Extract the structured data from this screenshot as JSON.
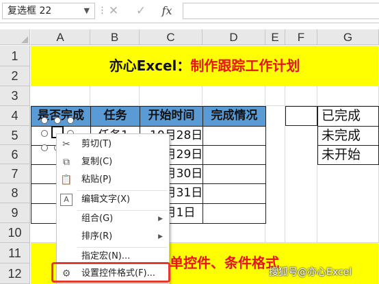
{
  "formula_bar": {
    "name_box": "复选框 22",
    "name_box_dropdown": "▼",
    "dots": "⋮",
    "cancel_icon": "✕",
    "enter_icon": "✓",
    "fx_label": "fx",
    "formula": ""
  },
  "columns": [
    "A",
    "B",
    "C",
    "D",
    "E",
    "F",
    "G"
  ],
  "rows": [
    "1",
    "2",
    "3",
    "4",
    "5",
    "6",
    "7",
    "8",
    "9",
    "10",
    "11",
    "12"
  ],
  "title": {
    "prefix": "亦心Excel：",
    "text": "制作跟踪工作计划"
  },
  "table": {
    "headers": [
      "是否完成",
      "任务",
      "开始时间",
      "完成情况"
    ],
    "rows": [
      {
        "task": "任务1",
        "date": "10月28日"
      },
      {
        "task": "",
        "date": "10月29日"
      },
      {
        "task": "",
        "date": "10月30日"
      },
      {
        "task": "",
        "date": "10月31日"
      },
      {
        "task": "",
        "date": "11月1日"
      }
    ]
  },
  "status_list": [
    "已完成",
    "未完成",
    "未开始"
  ],
  "bottom_banner": "单控件、条件格式",
  "context_menu": {
    "items": [
      {
        "label": "剪切(T)",
        "icon": "scissors-icon",
        "glyph": "✂",
        "disabled": false
      },
      {
        "label": "复制(C)",
        "icon": "copy-icon",
        "glyph": "⧉",
        "disabled": false
      },
      {
        "label": "粘贴(P)",
        "icon": "paste-icon",
        "glyph": "📋",
        "disabled": false
      },
      {
        "label": "编辑文字(X)",
        "icon": "edit-text-icon",
        "glyph": "A",
        "disabled": false
      },
      {
        "label": "组合(G)",
        "icon": "",
        "glyph": "",
        "disabled": false,
        "submenu": true
      },
      {
        "label": "排序(R)",
        "icon": "",
        "glyph": "",
        "disabled": false,
        "submenu": true
      },
      {
        "label": "指定宏(N)...",
        "icon": "",
        "glyph": "",
        "disabled": false
      },
      {
        "label": "设置控件格式(F)...",
        "icon": "format-control-icon",
        "glyph": "⚙",
        "disabled": false,
        "highlighted": true
      }
    ],
    "submenu_arrow": "▶"
  },
  "watermark": "搜狐号@亦心Excel",
  "colors": {
    "banner": "#ffff00",
    "title_red": "#e8141b",
    "header_blue": "#5b9bd5",
    "highlight_box": "#e53a2b"
  }
}
